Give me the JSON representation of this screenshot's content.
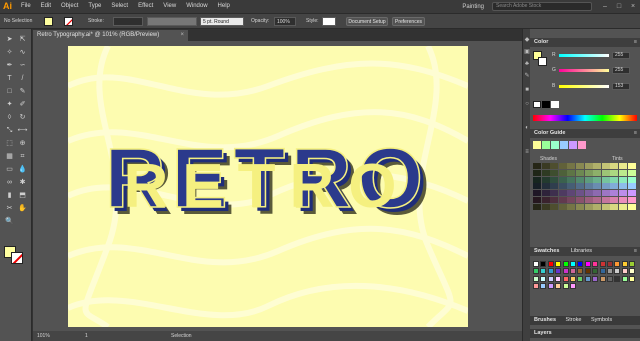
{
  "app": {
    "logo": "Ai"
  },
  "menubar": {
    "items": [
      "File",
      "Edit",
      "Object",
      "Type",
      "Select",
      "Effect",
      "View",
      "Window",
      "Help"
    ],
    "workspace": "Painting",
    "search_placeholder": "Search Adobe Stock",
    "win_buttons": [
      "–",
      "□",
      "×"
    ]
  },
  "controlbar": {
    "selection_label": "No Selection",
    "stroke_label": "Stroke:",
    "brush_label": "5 pt. Round",
    "opacity_label": "Opacity:",
    "opacity_value": "100%",
    "style_label": "Style:",
    "doc_setup": "Document Setup",
    "preferences": "Preferences"
  },
  "document": {
    "tab_title": "Retro Typography.ai* @ 101% (RGB/Preview)",
    "close": "×",
    "artwork_text": "RETRO"
  },
  "statusbar": {
    "zoom": "101%",
    "page": "1",
    "tool": "Selection"
  },
  "color_panel": {
    "title": "Color",
    "channels": [
      {
        "label": "R",
        "value": "255",
        "color": "#ff4040"
      },
      {
        "label": "G",
        "value": "255",
        "color": "#40c040"
      },
      {
        "label": "B",
        "value": "153",
        "color": "#4060ff"
      }
    ],
    "hex": "#FFFF99"
  },
  "color_guide": {
    "title": "Color Guide",
    "shades": "Shades",
    "tints": "Tints"
  },
  "swatches_panel": {
    "tabs": [
      "Swatches",
      "Libraries"
    ]
  },
  "bottom_tabs": [
    "Brushes",
    "Stroke",
    "Symbols"
  ],
  "layers_tab": "Layers",
  "tools": [
    "selection-tool",
    "direct-selection-tool",
    "magic-wand-tool",
    "lasso-tool",
    "pen-tool",
    "curvature-tool",
    "type-tool",
    "line-tool",
    "rectangle-tool",
    "paintbrush-tool",
    "shaper-tool",
    "pencil-tool",
    "eraser-tool",
    "rotate-tool",
    "scale-tool",
    "width-tool",
    "free-transform-tool",
    "shape-builder-tool",
    "perspective-tool",
    "mesh-tool",
    "gradient-tool",
    "eyedropper-tool",
    "blend-tool",
    "symbol-sprayer-tool",
    "column-graph-tool",
    "artboard-tool",
    "slice-tool",
    "hand-tool",
    "zoom-tool"
  ],
  "colors": {
    "fill": "#FFFFA0",
    "artboard": "#FDFCB0",
    "letter_front": "#2B3A8C",
    "letter_highlight": "#F5F080",
    "letter_shadow": "#5A5A3A"
  }
}
